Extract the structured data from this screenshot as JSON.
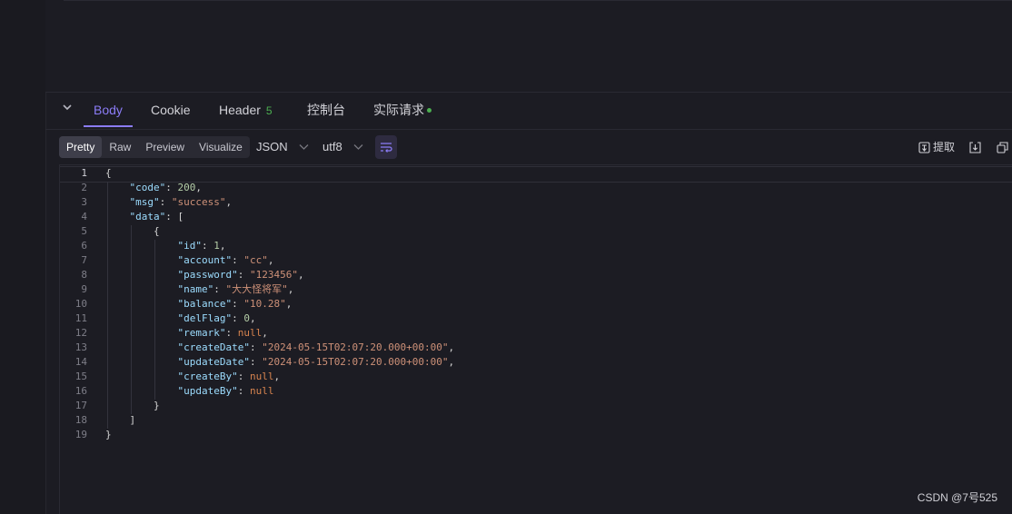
{
  "tabs": {
    "collapse_icon": "chevron-down-icon",
    "items": [
      {
        "label": "Body"
      },
      {
        "label": "Cookie"
      },
      {
        "label": "Header"
      },
      {
        "label": "控制台"
      },
      {
        "label": "实际请求"
      }
    ],
    "header_count": "5",
    "active": "Body"
  },
  "toolbar": {
    "view_modes": [
      "Pretty",
      "Raw",
      "Preview",
      "Visualize"
    ],
    "active_mode": "Pretty",
    "format": "JSON",
    "encoding": "utf8",
    "wrap_icon": "wrap-lines-icon",
    "extract_label": "提取",
    "extract_icon": "extract-icon",
    "download_icon": "download-icon",
    "copy_icon": "copy-icon"
  },
  "code": {
    "line_numbers": [
      "1",
      "2",
      "3",
      "4",
      "5",
      "6",
      "7",
      "8",
      "9",
      "10",
      "11",
      "12",
      "13",
      "14",
      "15",
      "16",
      "17",
      "18",
      "19"
    ],
    "current_line": "1"
  },
  "watermark": "CSDN @7号525",
  "colors": {
    "accent": "#8b7cf6",
    "background": "#1c1c23",
    "json_key": "#9cdcfe",
    "json_string": "#ce9178",
    "json_number": "#b5cea8",
    "status_green": "#4caf50"
  }
}
